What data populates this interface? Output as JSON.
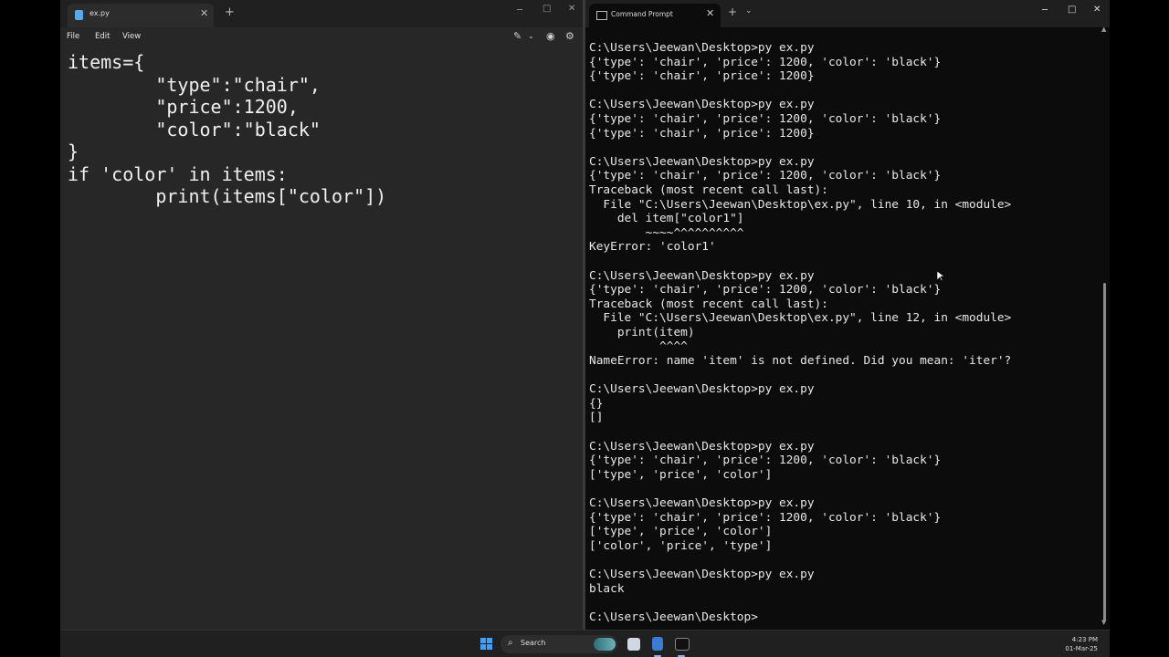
{
  "notepad": {
    "tab_title": "ex.py",
    "menu": [
      "File",
      "Edit",
      "View"
    ],
    "code_lines": [
      "items={",
      "        \"type\":\"chair\",",
      "        \"price\":1200,",
      "        \"color\":\"black\"",
      "}",
      "if 'color' in items:",
      "        print(items[\"color\"])"
    ]
  },
  "terminal": {
    "tab_title": "Command Prompt",
    "output_lines": [
      "C:\\Users\\Jeewan\\Desktop>py ex.py",
      "{'type': 'chair', 'price': 1200, 'color': 'black'}",
      "{'type': 'chair', 'price': 1200}",
      "",
      "C:\\Users\\Jeewan\\Desktop>py ex.py",
      "{'type': 'chair', 'price': 1200, 'color': 'black'}",
      "{'type': 'chair', 'price': 1200}",
      "",
      "C:\\Users\\Jeewan\\Desktop>py ex.py",
      "{'type': 'chair', 'price': 1200, 'color': 'black'}",
      "Traceback (most recent call last):",
      "  File \"C:\\Users\\Jeewan\\Desktop\\ex.py\", line 10, in <module>",
      "    del item[\"color1\"]",
      "        ~~~~^^^^^^^^^^",
      "KeyError: 'color1'",
      "",
      "C:\\Users\\Jeewan\\Desktop>py ex.py",
      "{'type': 'chair', 'price': 1200, 'color': 'black'}",
      "Traceback (most recent call last):",
      "  File \"C:\\Users\\Jeewan\\Desktop\\ex.py\", line 12, in <module>",
      "    print(item)",
      "          ^^^^",
      "NameError: name 'item' is not defined. Did you mean: 'iter'?",
      "",
      "C:\\Users\\Jeewan\\Desktop>py ex.py",
      "{}",
      "[]",
      "",
      "C:\\Users\\Jeewan\\Desktop>py ex.py",
      "{'type': 'chair', 'price': 1200, 'color': 'black'}",
      "['type', 'price', 'color']",
      "",
      "C:\\Users\\Jeewan\\Desktop>py ex.py",
      "{'type': 'chair', 'price': 1200, 'color': 'black'}",
      "['type', 'price', 'color']",
      "['color', 'price', 'type']",
      "",
      "C:\\Users\\Jeewan\\Desktop>py ex.py",
      "black",
      "",
      "C:\\Users\\Jeewan\\Desktop>"
    ]
  },
  "taskbar": {
    "search_placeholder": "Search",
    "clock_time": "4:23 PM",
    "clock_date": "01-Mar-25"
  },
  "icons": {
    "window_min": "─",
    "window_max": "□",
    "window_close": "✕",
    "new_tab": "+",
    "dropdown": "⌄"
  },
  "colors": {
    "notepad_bg": "#272727",
    "terminal_bg": "#0c0c0c",
    "windows_accent": "#3ea1ff"
  }
}
